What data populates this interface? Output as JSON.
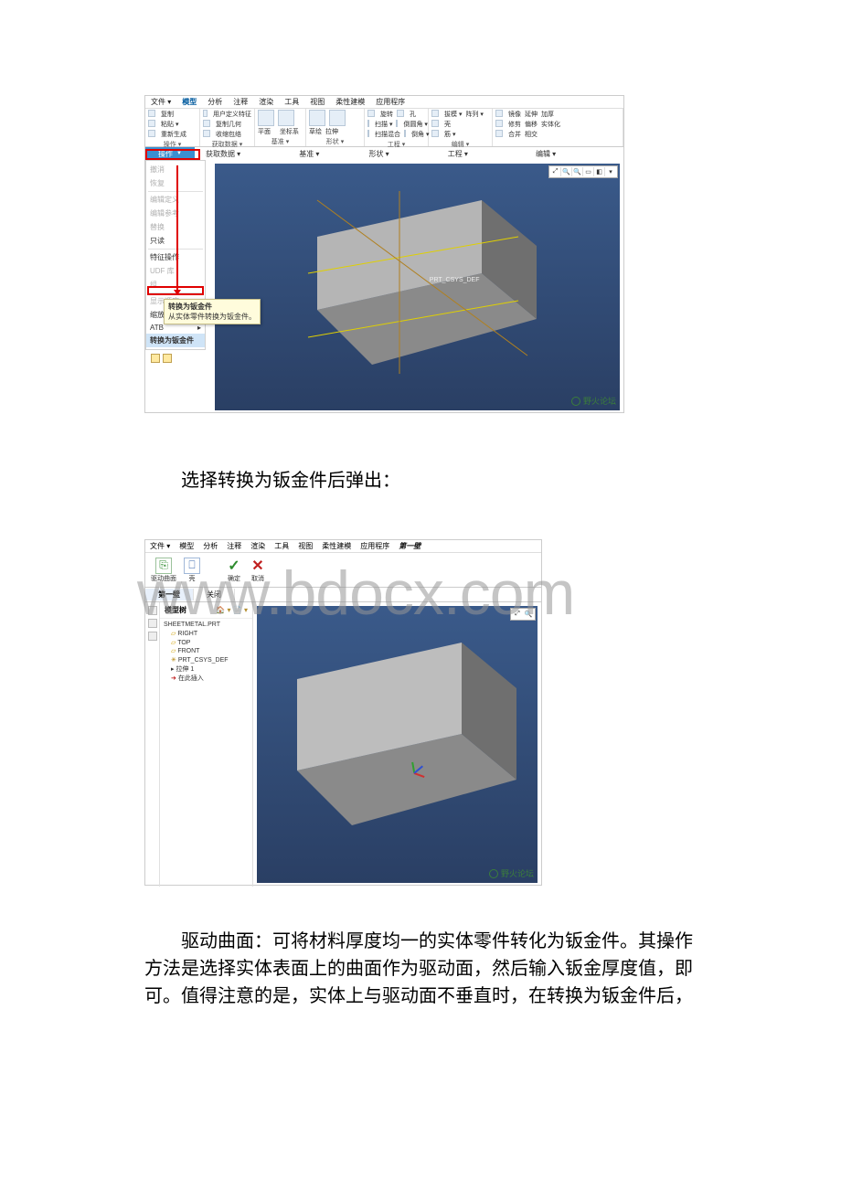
{
  "shot1": {
    "menubar": [
      "文件 ▾",
      "模型",
      "分析",
      "注释",
      "渲染",
      "工具",
      "视图",
      "柔性建模",
      "应用程序"
    ],
    "menubar_active": "模型",
    "ribbon_groups": [
      {
        "label": "操作 ▾",
        "items": [
          "复制",
          "粘贴 ▾",
          "重新生成",
          "用户定义特征",
          "复制几何",
          "收缩包络"
        ]
      },
      {
        "label": "获取数据 ▾",
        "items": [
          "平面",
          "坐标系",
          "✽",
          "✱ ▾"
        ]
      },
      {
        "label": "基准 ▾",
        "items": [
          "草绘",
          "拉伸",
          "旋转",
          "扫描 ▾",
          "扫描混合"
        ]
      },
      {
        "label": "形状 ▾",
        "items": [
          "孔",
          "倒圆角 ▾",
          "倒角 ▾",
          "拔模 ▾",
          "壳",
          "筋 ▾"
        ]
      },
      {
        "label": "工程 ▾",
        "items": [
          "阵列 ▾",
          "镜像",
          "修剪",
          "合并",
          "延伸",
          "偏移",
          "相交",
          "加厚",
          "实体化"
        ]
      },
      {
        "label": "编辑 ▾",
        "items": []
      }
    ],
    "op_button": "操作",
    "op_other": "获取数据 ▾",
    "sub_labels": [
      "基准 ▾",
      "形状 ▾",
      "工程 ▾",
      "编辑 ▾"
    ],
    "dropdown": [
      {
        "t": "撤消",
        "dim": true
      },
      {
        "t": "恢复",
        "dim": true
      },
      {
        "sep": true
      },
      {
        "t": "编辑定义",
        "dim": true
      },
      {
        "t": "编辑参考",
        "dim": true
      },
      {
        "t": "替换",
        "dim": true
      },
      {
        "t": "只读",
        "dim": false
      },
      {
        "sep": true
      },
      {
        "t": "特征操作",
        "dim": false
      },
      {
        "t": "UDF 库",
        "dim": true
      },
      {
        "t": "组",
        "dim": true
      },
      {
        "sep": true
      },
      {
        "t": "显示顺序",
        "dim": true
      },
      {
        "t": "缩放模型",
        "dim": false
      },
      {
        "t": "ATB",
        "dim": false,
        "arrow": true
      },
      {
        "t": "转换为钣金件",
        "dim": false,
        "hl": true
      }
    ],
    "tooltip_title": "转换为钣金件",
    "tooltip_body": "从实体零件转换为钣金件。",
    "csys_label": "PRT_CSYS_DEF",
    "side_tool": "🏠 ▾ 📄 ▾",
    "logo": "野火论坛"
  },
  "caption1": "选择转换为钣金件后弹出：",
  "shot2": {
    "menubar": [
      "文件 ▾",
      "模型",
      "分析",
      "注释",
      "渲染",
      "工具",
      "视图",
      "柔性建模",
      "应用程序"
    ],
    "ctx_tab": "第一壁",
    "ribbon": [
      {
        "glyph": "⎘",
        "label": "驱动曲面",
        "cls": "green"
      },
      {
        "glyph": "⚡",
        "label": "壳",
        "cls": "blue"
      },
      {
        "glyph": "✓",
        "label": "确定",
        "cls": "ok"
      },
      {
        "glyph": "✕",
        "label": "取消",
        "cls": "x"
      }
    ],
    "tabs": [
      "第一壁",
      "关闭"
    ],
    "tree_title": "模型树",
    "tree_tool": "🏠 ▾ 📄 ▾",
    "tree": [
      {
        "t": "SHEETMETAL.PRT",
        "cls": ""
      },
      {
        "t": "RIGHT",
        "cls": "ind1 plane"
      },
      {
        "t": "TOP",
        "cls": "ind1 plane"
      },
      {
        "t": "FRONT",
        "cls": "ind1 plane"
      },
      {
        "t": "PRT_CSYS_DEF",
        "cls": "ind1 csys"
      },
      {
        "t": "拉伸 1",
        "cls": "ind1 ext"
      },
      {
        "t": "在此插入",
        "cls": "ind1 ins"
      }
    ],
    "logo": "野火论坛"
  },
  "caption2": "驱动曲面：可将材料厚度均一的实体零件转化为钣金件。其操作方法是选择实体表面上的曲面作为驱动面，然后输入钣金厚度值，即可。值得注意的是，实体上与驱动面不垂直时，在转换为钣金件后，",
  "watermark": "www.bdocx.com"
}
